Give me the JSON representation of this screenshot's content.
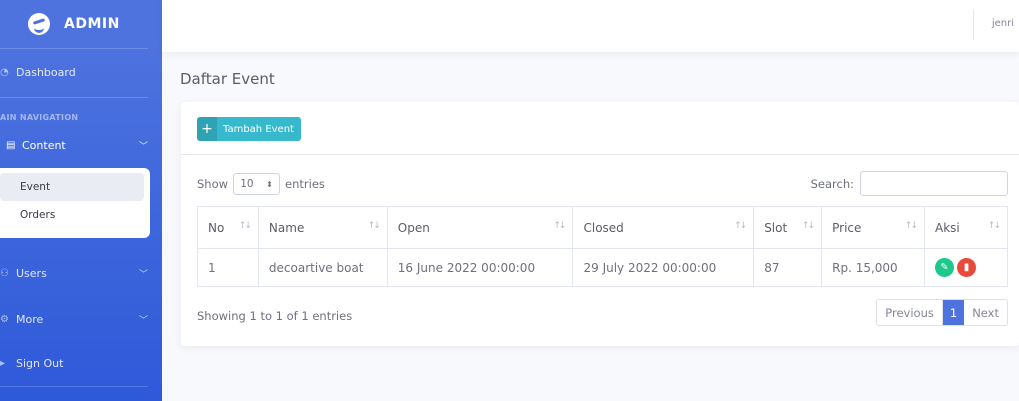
{
  "sidebar": {
    "brand": "ADMIN",
    "dashboard": "Dashboard",
    "heading": "AIN NAVIGATION",
    "content": "Content",
    "submenu": [
      "Event",
      "Orders"
    ],
    "users": "Users",
    "more": "More",
    "sign_out": "Sign Out"
  },
  "topbar": {
    "user": "jenri"
  },
  "page": {
    "title": "Daftar Event"
  },
  "card": {
    "add_button": "Tambah Event",
    "show_label": "Show",
    "entries_value": "10",
    "entries_label": "entries",
    "search_label": "Search:",
    "search_value": "",
    "columns": [
      "No",
      "Name",
      "Open",
      "Closed",
      "Slot",
      "Price",
      "Aksi"
    ],
    "rows": [
      {
        "no": "1",
        "name": "decoartive boat",
        "open": "16 June 2022 00:00:00",
        "closed": "29 July 2022 00:00:00",
        "slot": "87",
        "price": "Rp. 15,000"
      }
    ],
    "info": "Showing 1 to 1 of 1 entries",
    "pagination": {
      "previous": "Previous",
      "current": "1",
      "next": "Next"
    }
  },
  "colors": {
    "sidebar": "#4e73df",
    "add_button": "#36b9cc",
    "edit": "#1cc88a",
    "delete": "#e74a3b",
    "page_active": "#4e73df"
  },
  "icons": {
    "brand": "laugh-wink-icon",
    "edit": "pencil-icon",
    "delete": "trash-icon",
    "add": "plus-icon"
  }
}
